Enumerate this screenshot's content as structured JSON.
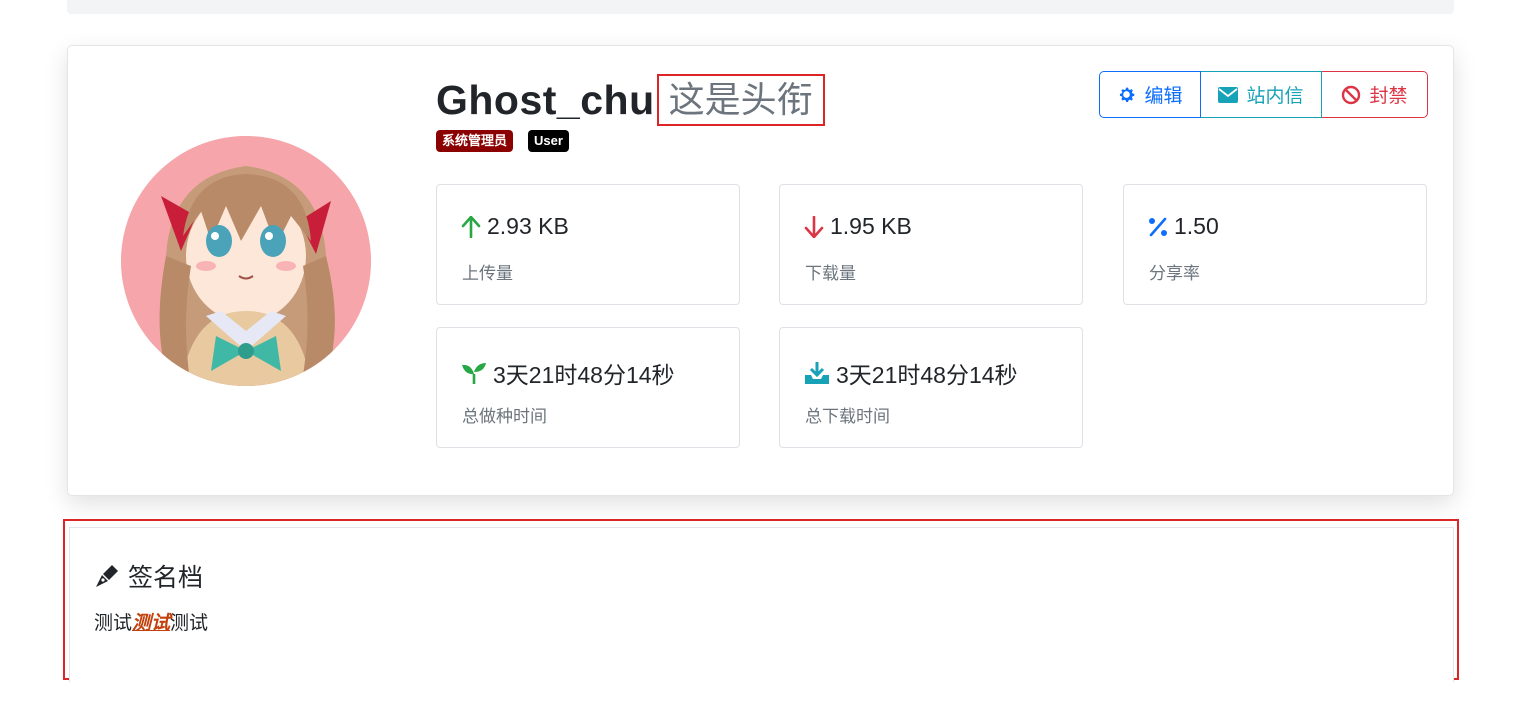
{
  "profile": {
    "username": "Ghost_chu",
    "title": "这是头衔",
    "badges": [
      {
        "label": "系统管理员",
        "color": "#8b0000"
      },
      {
        "label": "User",
        "color": "#000000"
      }
    ]
  },
  "actions": {
    "edit_label": "编辑",
    "message_label": "站内信",
    "ban_label": "封禁"
  },
  "stats": {
    "upload": {
      "value": "2.93 KB",
      "label": "上传量",
      "icon": "arrow-up-icon",
      "color": "#28a745"
    },
    "download": {
      "value": "1.95 KB",
      "label": "下载量",
      "icon": "arrow-down-icon",
      "color": "#dc3545"
    },
    "ratio": {
      "value": "1.50",
      "label": "分享率",
      "icon": "percent-icon",
      "color": "#0d6efd"
    },
    "seed_time": {
      "value": "3天21时48分14秒",
      "label": "总做种时间",
      "icon": "seedling-icon",
      "color": "#28a745"
    },
    "download_time": {
      "value": "3天21时48分14秒",
      "label": "总下载时间",
      "icon": "download-tray-icon",
      "color": "#17a2b8"
    }
  },
  "signature": {
    "title": "签名档",
    "text_before": "测试",
    "text_emphasis": "测试",
    "text_after": "测试",
    "icon": "pen-nib-icon"
  }
}
